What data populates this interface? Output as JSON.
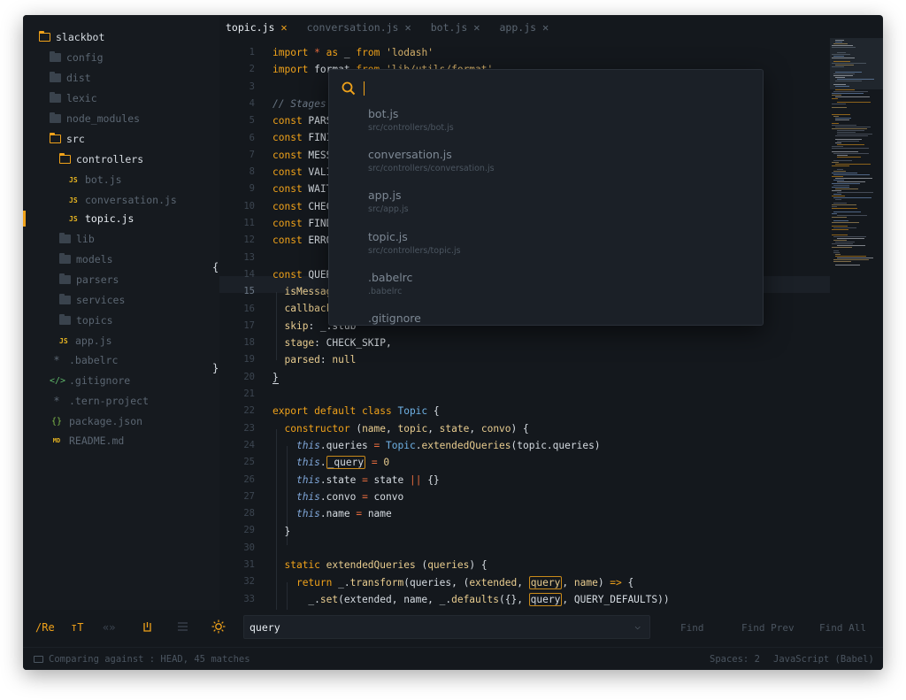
{
  "sidebar": {
    "root": "slackbot",
    "items": [
      {
        "label": "config",
        "type": "folder"
      },
      {
        "label": "dist",
        "type": "folder"
      },
      {
        "label": "lexic",
        "type": "folder"
      },
      {
        "label": "node_modules",
        "type": "folder"
      },
      {
        "label": "src",
        "type": "folder-open"
      },
      {
        "label": "controllers",
        "type": "folder-open"
      },
      {
        "label": "bot.js",
        "type": "js"
      },
      {
        "label": "conversation.js",
        "type": "js"
      },
      {
        "label": "topic.js",
        "type": "js-active"
      },
      {
        "label": "lib",
        "type": "folder"
      },
      {
        "label": "models",
        "type": "folder"
      },
      {
        "label": "parsers",
        "type": "folder"
      },
      {
        "label": "services",
        "type": "folder"
      },
      {
        "label": "topics",
        "type": "folder"
      },
      {
        "label": "app.js",
        "type": "js"
      },
      {
        "label": ".babelrc",
        "type": "star"
      },
      {
        "label": ".gitignore",
        "type": "code"
      },
      {
        "label": ".tern-project",
        "type": "star"
      },
      {
        "label": "package.json",
        "type": "braces"
      },
      {
        "label": "README.md",
        "type": "md"
      }
    ]
  },
  "tabs": [
    {
      "label": "topic.js",
      "active": true
    },
    {
      "label": "conversation.js",
      "active": false
    },
    {
      "label": "bot.js",
      "active": false
    },
    {
      "label": "app.js",
      "active": false
    }
  ],
  "line_numbers": [
    "1",
    "2",
    "3",
    "4",
    "5",
    "6",
    "7",
    "8",
    "9",
    "10",
    "11",
    "12",
    "13",
    "14",
    "15",
    "16",
    "17",
    "18",
    "19",
    "20",
    "21",
    "22",
    "23",
    "24",
    "25",
    "26",
    "27",
    "28",
    "29",
    "30",
    "31",
    "32",
    "33"
  ],
  "palette": {
    "query": "",
    "items": [
      {
        "name": "bot.js",
        "path": "src/controllers/bot.js"
      },
      {
        "name": "conversation.js",
        "path": "src/controllers/conversation.js"
      },
      {
        "name": "app.js",
        "path": "src/app.js"
      },
      {
        "name": "topic.js",
        "path": "src/controllers/topic.js"
      },
      {
        "name": ".babelrc",
        "path": ".babelrc"
      },
      {
        "name": ".gitignore",
        "path": ""
      }
    ]
  },
  "findbar": {
    "regex_label": "/Re",
    "case_label": "тT",
    "word_label": "«»",
    "query": "query",
    "find": "Find",
    "find_prev": "Find Prev",
    "find_all": "Find All"
  },
  "status": {
    "left": "Comparing against : HEAD, 45 matches",
    "spaces": "Spaces: 2",
    "language": "JavaScript (Babel)"
  },
  "colors": {
    "accent": "#f0a21a",
    "background": "#14181d",
    "sidebar": "#161a1f"
  }
}
